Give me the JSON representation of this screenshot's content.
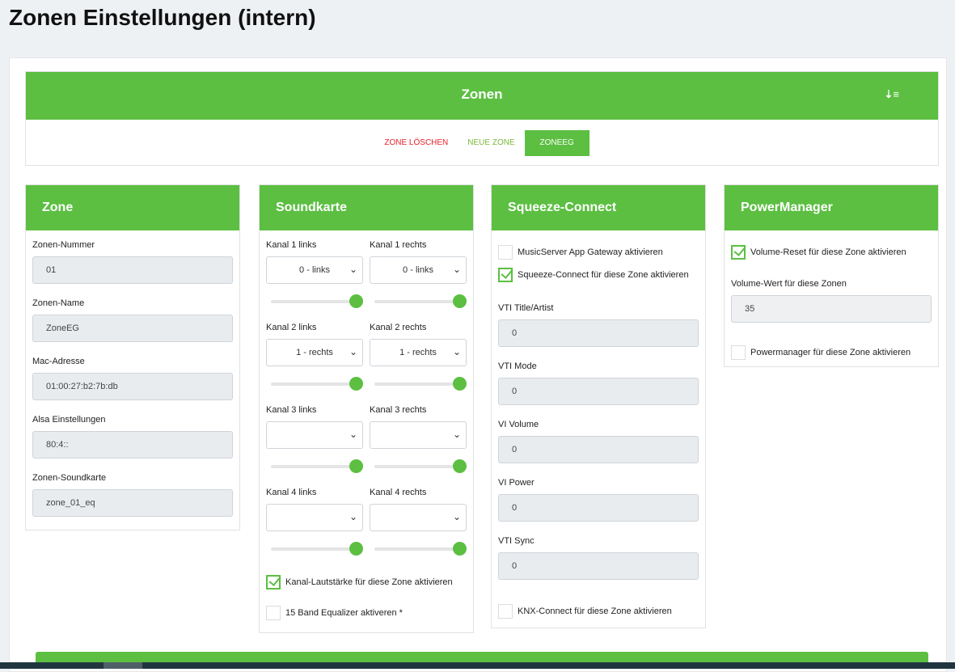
{
  "title": "Zonen Einstellungen (intern)",
  "zonen": {
    "title": "Zonen",
    "delete": "ZONE LÖSCHEN",
    "new": "NEUE ZONE",
    "current": "ZONEEG"
  },
  "zone": {
    "title": "Zone",
    "fields": [
      {
        "label": "Zonen-Nummer",
        "value": "01"
      },
      {
        "label": "Zonen-Name",
        "value": "ZoneEG"
      },
      {
        "label": "Mac-Adresse",
        "value": "01:00:27:b2:7b:db"
      },
      {
        "label": "Alsa Einstellungen",
        "value": "80:4::"
      },
      {
        "label": "Zonen-Soundkarte",
        "value": "zone_01_eq"
      }
    ]
  },
  "sound": {
    "title": "Soundkarte",
    "channels": [
      {
        "l": "Kanal 1 links",
        "lv": "0 - links",
        "r": "Kanal 1 rechts",
        "rv": "0 - links"
      },
      {
        "l": "Kanal 2 links",
        "lv": "1 - rechts",
        "r": "Kanal 2 rechts",
        "rv": "1 - rechts"
      },
      {
        "l": "Kanal 3 links",
        "lv": "",
        "r": "Kanal 3 rechts",
        "rv": ""
      },
      {
        "l": "Kanal 4 links",
        "lv": "",
        "r": "Kanal 4 rechts",
        "rv": ""
      }
    ],
    "volume_cb": "Kanal-Lautstärke für diese Zone aktivieren",
    "eq_cb": "15 Band Equalizer aktiveren *"
  },
  "squeeze": {
    "title": "Squeeze-Connect",
    "gateway_cb": "MusicServer App Gateway aktivieren",
    "sc_cb": "Squeeze-Connect für diese Zone aktivieren",
    "fields": [
      {
        "label": "VTI Title/Artist",
        "value": "0"
      },
      {
        "label": "VTI Mode",
        "value": "0"
      },
      {
        "label": "VI Volume",
        "value": "0"
      },
      {
        "label": "VI Power",
        "value": "0"
      },
      {
        "label": "VTI Sync",
        "value": "0"
      }
    ],
    "knx_cb": "KNX-Connect für diese Zone aktivieren"
  },
  "power": {
    "title": "PowerManager",
    "reset_cb": "Volume-Reset für diese Zone aktivieren",
    "vol_label": "Volume-Wert für diese Zonen",
    "vol_value": "35",
    "pm_cb": "Powermanager für diese Zone aktivieren"
  },
  "colors": {
    "accent": "#5cbf42",
    "danger": "#e8212b"
  }
}
